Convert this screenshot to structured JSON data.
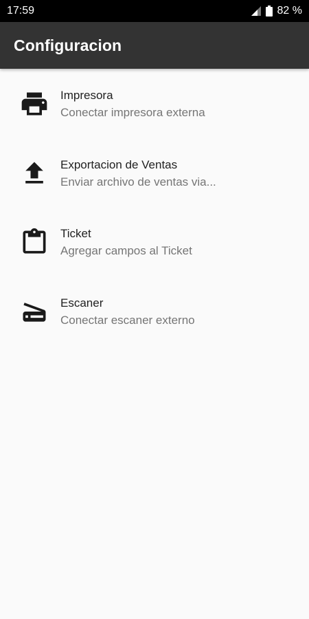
{
  "status_bar": {
    "time": "17:59",
    "battery": "82 %",
    "icons": [
      "signal-icon",
      "battery-icon"
    ]
  },
  "app_bar": {
    "title": "Configuracion",
    "background": "#333333"
  },
  "settings": [
    {
      "icon": "printer-icon",
      "title": "Impresora",
      "subtitle": "Conectar impresora externa"
    },
    {
      "icon": "upload-icon",
      "title": "Exportacion de Ventas",
      "subtitle": "Enviar archivo de ventas via..."
    },
    {
      "icon": "clipboard-icon",
      "title": "Ticket",
      "subtitle": "Agregar campos al Ticket"
    },
    {
      "icon": "scanner-icon",
      "title": "Escaner",
      "subtitle": "Conectar escaner externo"
    }
  ]
}
